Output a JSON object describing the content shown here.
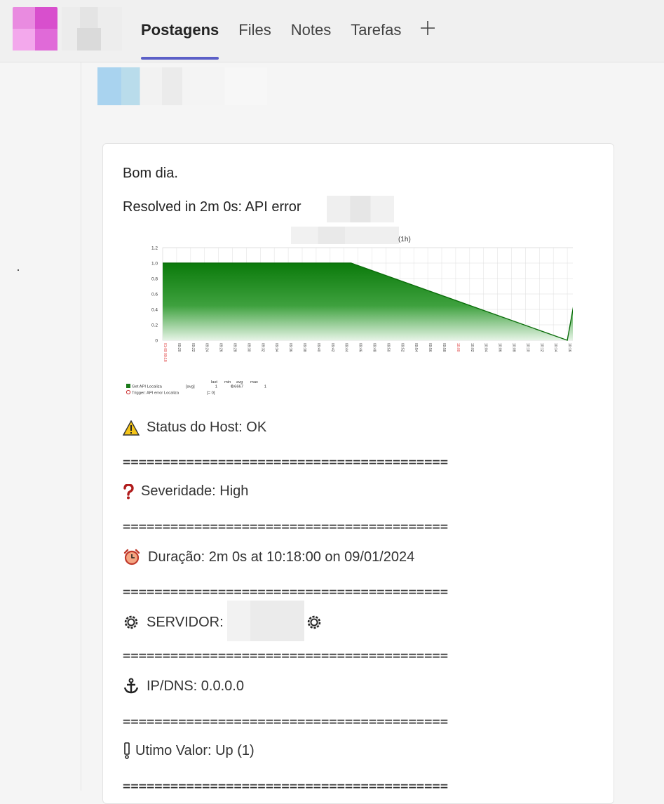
{
  "header": {
    "tabs": [
      {
        "label": "Postagens",
        "active": true
      },
      {
        "label": "Files",
        "active": false
      },
      {
        "label": "Notes",
        "active": false
      },
      {
        "label": "Tarefas",
        "active": false
      }
    ],
    "add_tab_icon": "plus-icon"
  },
  "message": {
    "greeting": "Bom dia.",
    "resolved": "Resolved in 2m 0s: API error",
    "graph_suffix": "(1h)",
    "status": "Status do Host: OK",
    "separator": "=========================================",
    "severity": "Severidade: High",
    "duration": "Duração: 2m 0s at 10:18:00 on 09/01/2024",
    "server": "SERVIDOR:",
    "ip": "IP/DNS: 0.0.0.0",
    "last_value": "Utimo Valor: Up (1)"
  },
  "chart_data": {
    "type": "area",
    "y_ticks": [
      "1.2",
      "1.0",
      "0.8",
      "0.6",
      "0.4",
      "0.2",
      "0"
    ],
    "ylim": [
      0,
      1.2
    ],
    "x_ticks": [
      "01-09 09:18",
      "09:20",
      "09:22",
      "09:24",
      "09:26",
      "09:28",
      "09:30",
      "09:32",
      "09:34",
      "09:36",
      "09:38",
      "09:40",
      "09:42",
      "09:44",
      "09:46",
      "09:48",
      "09:50",
      "09:52",
      "09:54",
      "09:56",
      "09:58",
      "10:00",
      "10:02",
      "10:04",
      "10:06",
      "10:08",
      "10:10",
      "10:12",
      "10:14",
      "10:16",
      "01-09 10:18"
    ],
    "red_ticks": [
      "01-09 09:18",
      "10:00",
      "01-09 10:18"
    ],
    "series": [
      {
        "name": "Get API Localiza",
        "x": [
          "09:18",
          "09:45",
          "10:16",
          "10:18"
        ],
        "values": [
          1,
          1,
          0,
          1
        ]
      }
    ],
    "legend": {
      "headers": [
        "last",
        "min",
        "avg",
        "max"
      ],
      "rows": [
        {
          "name": "Get API Localiza",
          "agg": "[avg]",
          "last": "1",
          "min": "0",
          "avg": "0.6667",
          "max": "1",
          "color": "#1a7a1a"
        },
        {
          "name": "Trigger: API error Localiza",
          "agg": "[= 0]",
          "color": "#cc3333"
        }
      ]
    },
    "grid": true
  }
}
